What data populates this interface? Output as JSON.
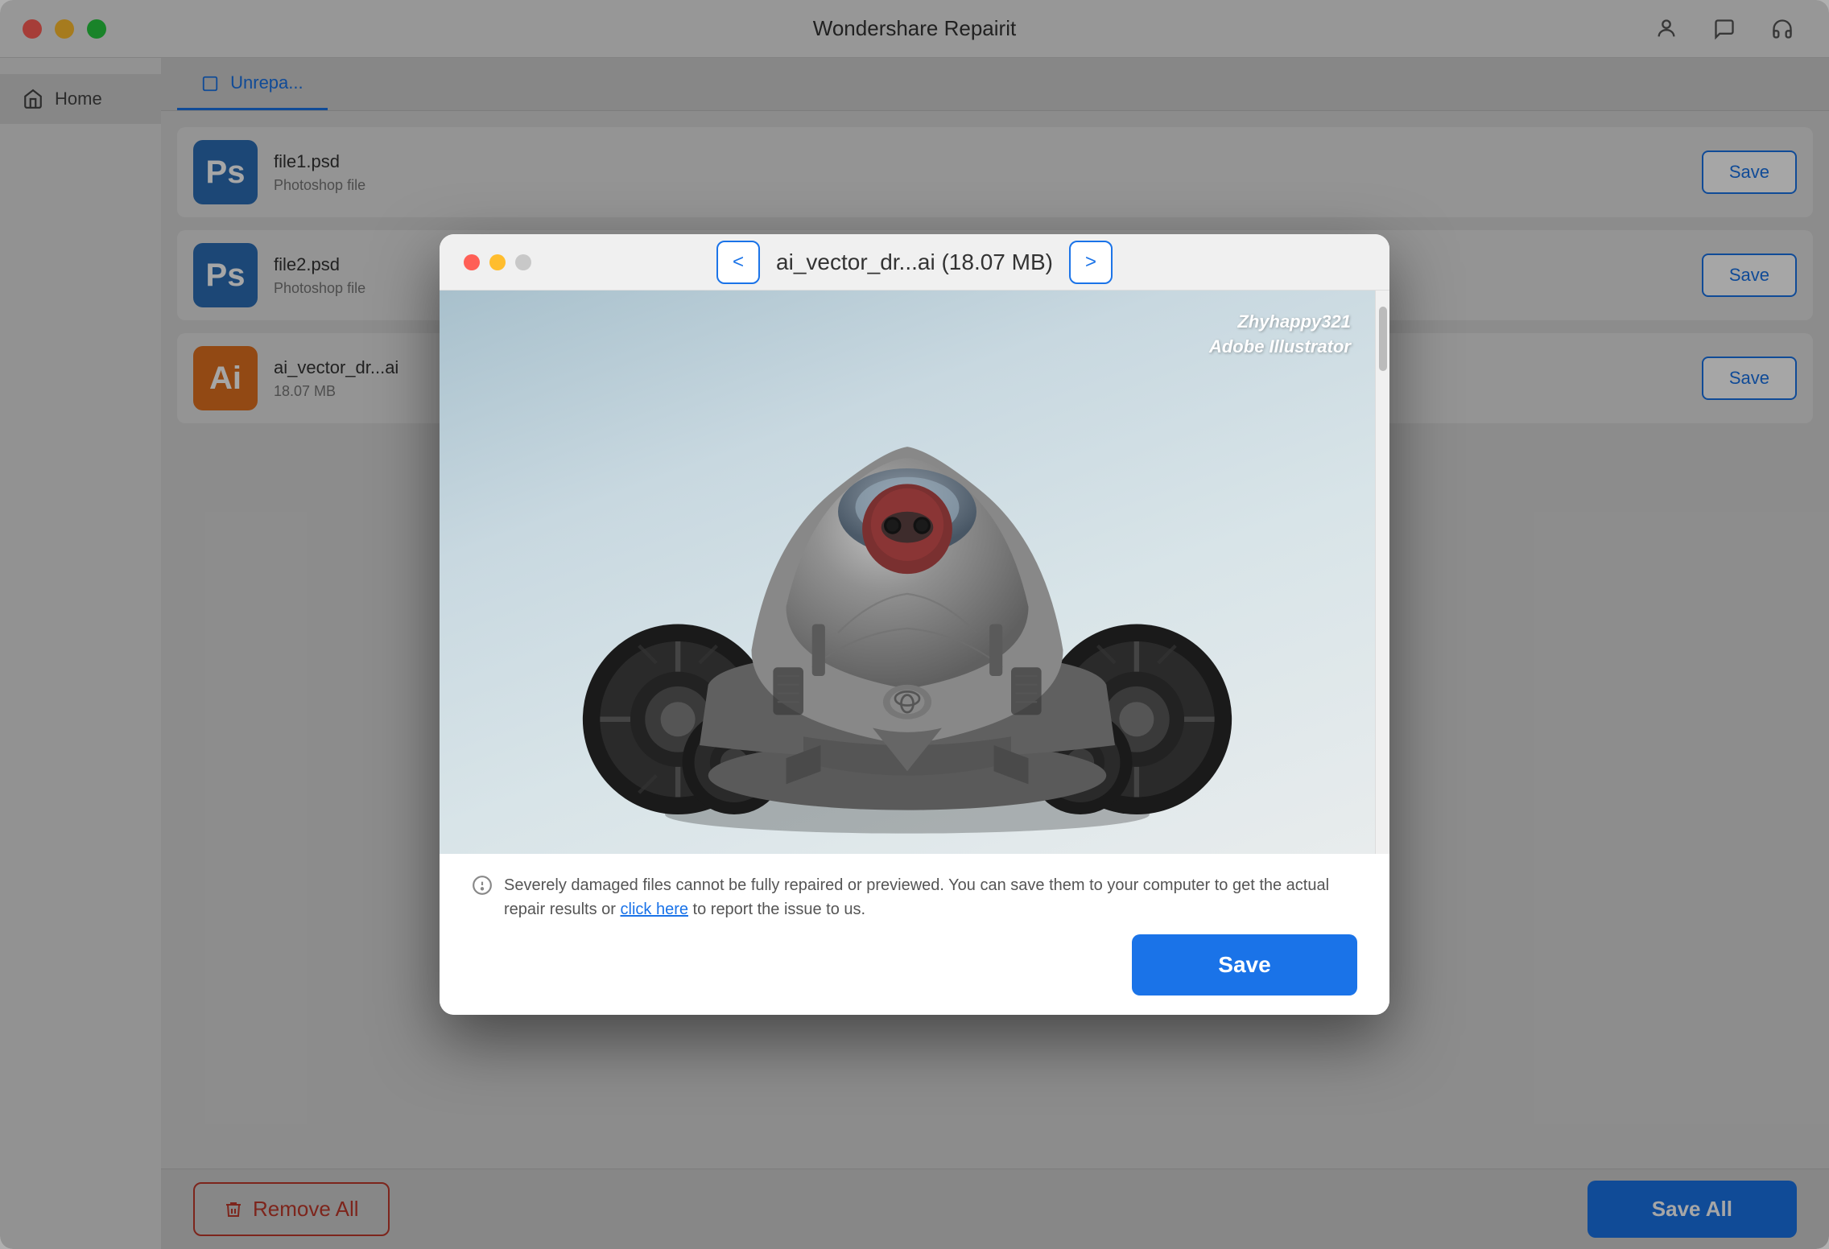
{
  "app": {
    "title": "Wondershare Repairit",
    "traffic_lights": [
      "close",
      "minimize",
      "maximize"
    ]
  },
  "titlebar": {
    "title": "Wondershare Repairit",
    "icons": [
      "person-icon",
      "chat-icon",
      "headset-icon"
    ]
  },
  "sidebar": {
    "items": [
      {
        "id": "home",
        "label": "Home",
        "icon": "home-icon",
        "active": true
      }
    ]
  },
  "main": {
    "tabs": [
      {
        "id": "unrepairable",
        "label": "Unrepa...",
        "active": true
      }
    ],
    "files": [
      {
        "id": 1,
        "icon_type": "ps",
        "icon_label": "Ps",
        "name": "file1.psd",
        "meta": "Photoshop file",
        "save_label": "Save"
      },
      {
        "id": 2,
        "icon_type": "ps",
        "icon_label": "Ps",
        "name": "file2.psd",
        "meta": "Photoshop file",
        "save_label": "Save"
      },
      {
        "id": 3,
        "icon_type": "ai",
        "icon_label": "Ai",
        "name": "ai_vector_dr...ai",
        "meta": "18.07 MB",
        "save_label": "Save"
      }
    ],
    "bottom_bar": {
      "remove_all_label": "Remove All",
      "save_all_label": "Save All"
    }
  },
  "modal": {
    "filename": "ai_vector_dr...ai (18.07 MB)",
    "prev_label": "<",
    "next_label": ">",
    "image_credit_line1": "Zhyhappy321",
    "image_credit_line2": "Adobe Illustrator",
    "warning_text": "Severely damaged files cannot be fully repaired or previewed. You can save them to your computer to get the actual repair results or ",
    "warning_link": "click here",
    "warning_suffix": " to report the issue to us.",
    "save_label": "Save",
    "scrollbar": {
      "visible": true
    }
  },
  "colors": {
    "accent_blue": "#1a73e8",
    "remove_red": "#c0392b",
    "ps_blue": "#2b6db5",
    "ai_orange": "#e07020"
  }
}
